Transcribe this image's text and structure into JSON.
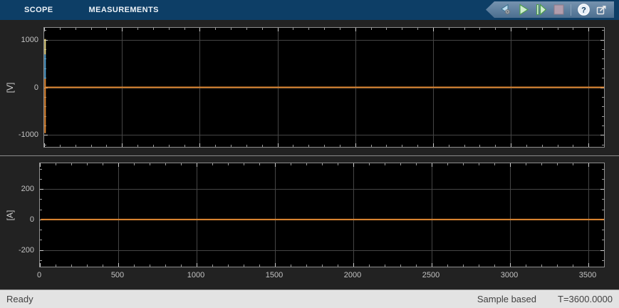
{
  "toolstrip": {
    "tabs": [
      {
        "label": "SCOPE"
      },
      {
        "label": "MEASUREMENTS"
      }
    ],
    "buttons": [
      {
        "icon": "step-back-settings-icon"
      },
      {
        "icon": "run-icon"
      },
      {
        "icon": "step-forward-icon"
      },
      {
        "icon": "stop-icon"
      },
      {
        "icon": "help-icon"
      },
      {
        "icon": "pop-out-icon"
      }
    ],
    "help_glyph": "?"
  },
  "status_bar": {
    "left": "Ready",
    "sample_mode": "Sample based",
    "time": "T=3600.0000"
  },
  "colors": {
    "toolstrip_bg": "#0d3e66",
    "figure_bg": "#222222",
    "axes_bg": "#000000",
    "axes_border": "#8f8f8f",
    "grid": "#454545",
    "tick_major": "#d0d0d0",
    "tick_minor": "#9a9a9a",
    "signal_yellow": "#e9d884",
    "signal_blue": "#4e9fd1",
    "signal_orange": "#e0862f",
    "status_bg": "#e3e3e3"
  },
  "chart_data": [
    {
      "type": "line",
      "name": "voltage-scope",
      "title": "",
      "xlabel": "",
      "ylabel": "[V]",
      "xlim": [
        0,
        3600
      ],
      "ylim": [
        -1250,
        1250
      ],
      "x_ticks": [
        0,
        500,
        1000,
        1500,
        2000,
        2500,
        3000,
        3500
      ],
      "y_ticks": [
        1000,
        0,
        -1000
      ],
      "show_x_tick_labels": false,
      "x_minor_per_major": 5,
      "y_minor_per_major": 5,
      "grid": true,
      "legend": "none",
      "series": [
        {
          "name": "signal-1",
          "color": "#e9d884",
          "points": [
            [
              0,
              1015
            ],
            [
              0,
              690
            ]
          ]
        },
        {
          "name": "signal-2",
          "color": "#4e9fd1",
          "points": [
            [
              0,
              690
            ],
            [
              0,
              180
            ]
          ]
        },
        {
          "name": "signal-3",
          "color": "#e0862f",
          "points": [
            [
              0,
              180
            ],
            [
              0,
              -950
            ],
            [
              0,
              0
            ],
            [
              3600,
              0
            ]
          ]
        }
      ]
    },
    {
      "type": "line",
      "name": "current-scope",
      "title": "",
      "xlabel": "",
      "ylabel": "[A]",
      "xlim": [
        0,
        3600
      ],
      "ylim": [
        -310,
        370
      ],
      "x_ticks": [
        0,
        500,
        1000,
        1500,
        2000,
        2500,
        3000,
        3500
      ],
      "y_ticks": [
        200,
        0,
        -200
      ],
      "show_x_tick_labels": true,
      "x_minor_per_major": 5,
      "y_minor_per_major": 3,
      "grid": true,
      "legend": "none",
      "series": [
        {
          "name": "signal-current",
          "color": "#e0862f",
          "points": [
            [
              0,
              0
            ],
            [
              3600,
              0
            ]
          ]
        }
      ]
    }
  ]
}
